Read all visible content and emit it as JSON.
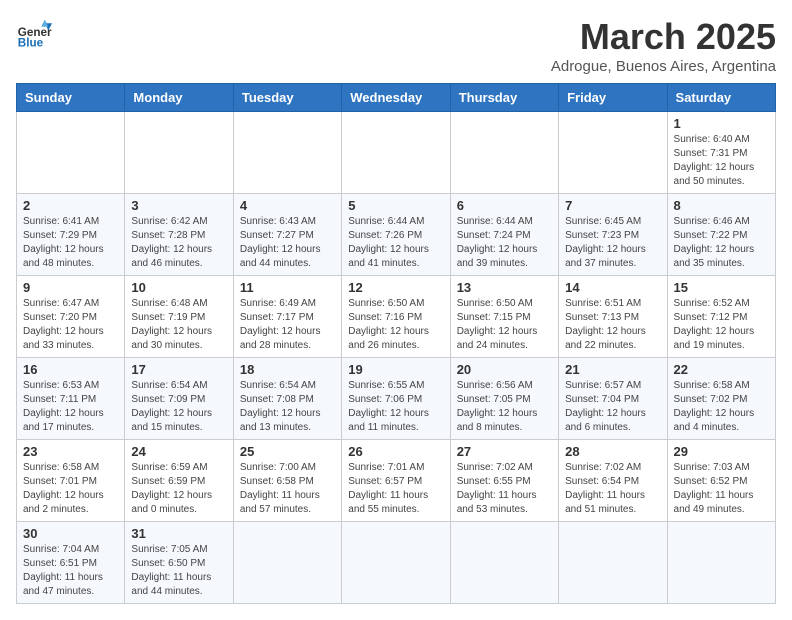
{
  "header": {
    "logo_general": "General",
    "logo_blue": "Blue",
    "month_title": "March 2025",
    "location": "Adrogue, Buenos Aires, Argentina"
  },
  "weekdays": [
    "Sunday",
    "Monday",
    "Tuesday",
    "Wednesday",
    "Thursday",
    "Friday",
    "Saturday"
  ],
  "weeks": [
    [
      {
        "day": "",
        "info": ""
      },
      {
        "day": "",
        "info": ""
      },
      {
        "day": "",
        "info": ""
      },
      {
        "day": "",
        "info": ""
      },
      {
        "day": "",
        "info": ""
      },
      {
        "day": "",
        "info": ""
      },
      {
        "day": "1",
        "info": "Sunrise: 6:40 AM\nSunset: 7:31 PM\nDaylight: 12 hours and 50 minutes."
      }
    ],
    [
      {
        "day": "2",
        "info": "Sunrise: 6:41 AM\nSunset: 7:29 PM\nDaylight: 12 hours and 48 minutes."
      },
      {
        "day": "3",
        "info": "Sunrise: 6:42 AM\nSunset: 7:28 PM\nDaylight: 12 hours and 46 minutes."
      },
      {
        "day": "4",
        "info": "Sunrise: 6:43 AM\nSunset: 7:27 PM\nDaylight: 12 hours and 44 minutes."
      },
      {
        "day": "5",
        "info": "Sunrise: 6:44 AM\nSunset: 7:26 PM\nDaylight: 12 hours and 41 minutes."
      },
      {
        "day": "6",
        "info": "Sunrise: 6:44 AM\nSunset: 7:24 PM\nDaylight: 12 hours and 39 minutes."
      },
      {
        "day": "7",
        "info": "Sunrise: 6:45 AM\nSunset: 7:23 PM\nDaylight: 12 hours and 37 minutes."
      },
      {
        "day": "8",
        "info": "Sunrise: 6:46 AM\nSunset: 7:22 PM\nDaylight: 12 hours and 35 minutes."
      }
    ],
    [
      {
        "day": "9",
        "info": "Sunrise: 6:47 AM\nSunset: 7:20 PM\nDaylight: 12 hours and 33 minutes."
      },
      {
        "day": "10",
        "info": "Sunrise: 6:48 AM\nSunset: 7:19 PM\nDaylight: 12 hours and 30 minutes."
      },
      {
        "day": "11",
        "info": "Sunrise: 6:49 AM\nSunset: 7:17 PM\nDaylight: 12 hours and 28 minutes."
      },
      {
        "day": "12",
        "info": "Sunrise: 6:50 AM\nSunset: 7:16 PM\nDaylight: 12 hours and 26 minutes."
      },
      {
        "day": "13",
        "info": "Sunrise: 6:50 AM\nSunset: 7:15 PM\nDaylight: 12 hours and 24 minutes."
      },
      {
        "day": "14",
        "info": "Sunrise: 6:51 AM\nSunset: 7:13 PM\nDaylight: 12 hours and 22 minutes."
      },
      {
        "day": "15",
        "info": "Sunrise: 6:52 AM\nSunset: 7:12 PM\nDaylight: 12 hours and 19 minutes."
      }
    ],
    [
      {
        "day": "16",
        "info": "Sunrise: 6:53 AM\nSunset: 7:11 PM\nDaylight: 12 hours and 17 minutes."
      },
      {
        "day": "17",
        "info": "Sunrise: 6:54 AM\nSunset: 7:09 PM\nDaylight: 12 hours and 15 minutes."
      },
      {
        "day": "18",
        "info": "Sunrise: 6:54 AM\nSunset: 7:08 PM\nDaylight: 12 hours and 13 minutes."
      },
      {
        "day": "19",
        "info": "Sunrise: 6:55 AM\nSunset: 7:06 PM\nDaylight: 12 hours and 11 minutes."
      },
      {
        "day": "20",
        "info": "Sunrise: 6:56 AM\nSunset: 7:05 PM\nDaylight: 12 hours and 8 minutes."
      },
      {
        "day": "21",
        "info": "Sunrise: 6:57 AM\nSunset: 7:04 PM\nDaylight: 12 hours and 6 minutes."
      },
      {
        "day": "22",
        "info": "Sunrise: 6:58 AM\nSunset: 7:02 PM\nDaylight: 12 hours and 4 minutes."
      }
    ],
    [
      {
        "day": "23",
        "info": "Sunrise: 6:58 AM\nSunset: 7:01 PM\nDaylight: 12 hours and 2 minutes."
      },
      {
        "day": "24",
        "info": "Sunrise: 6:59 AM\nSunset: 6:59 PM\nDaylight: 12 hours and 0 minutes."
      },
      {
        "day": "25",
        "info": "Sunrise: 7:00 AM\nSunset: 6:58 PM\nDaylight: 11 hours and 57 minutes."
      },
      {
        "day": "26",
        "info": "Sunrise: 7:01 AM\nSunset: 6:57 PM\nDaylight: 11 hours and 55 minutes."
      },
      {
        "day": "27",
        "info": "Sunrise: 7:02 AM\nSunset: 6:55 PM\nDaylight: 11 hours and 53 minutes."
      },
      {
        "day": "28",
        "info": "Sunrise: 7:02 AM\nSunset: 6:54 PM\nDaylight: 11 hours and 51 minutes."
      },
      {
        "day": "29",
        "info": "Sunrise: 7:03 AM\nSunset: 6:52 PM\nDaylight: 11 hours and 49 minutes."
      }
    ],
    [
      {
        "day": "30",
        "info": "Sunrise: 7:04 AM\nSunset: 6:51 PM\nDaylight: 11 hours and 47 minutes."
      },
      {
        "day": "31",
        "info": "Sunrise: 7:05 AM\nSunset: 6:50 PM\nDaylight: 11 hours and 44 minutes."
      },
      {
        "day": "",
        "info": ""
      },
      {
        "day": "",
        "info": ""
      },
      {
        "day": "",
        "info": ""
      },
      {
        "day": "",
        "info": ""
      },
      {
        "day": "",
        "info": ""
      }
    ]
  ]
}
